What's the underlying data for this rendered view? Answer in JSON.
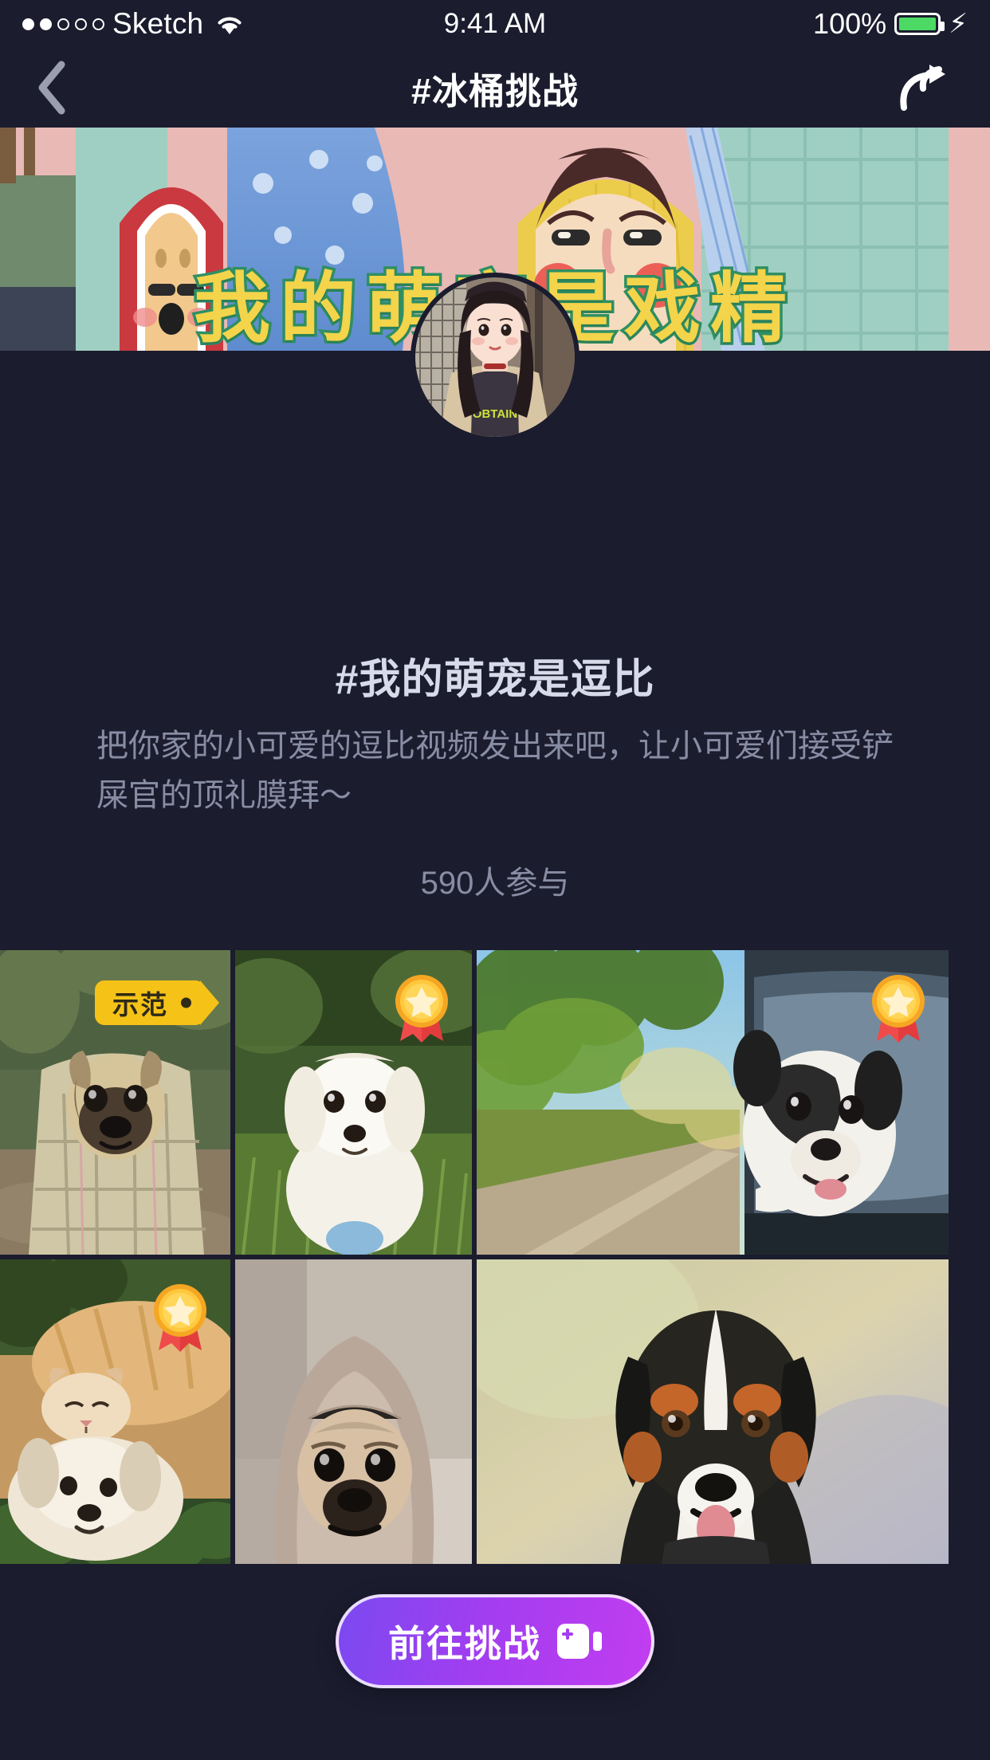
{
  "statusbar": {
    "carrier": "Sketch",
    "time": "9:41 AM",
    "battery_pct": "100%",
    "signal_dots_filled": 2,
    "signal_dots_total": 5,
    "wifi_icon": "wifi-icon",
    "battery_icon": "battery-icon",
    "charging_icon": "lightning-bolt-icon",
    "colors": {
      "battery_fill": "#4cd964",
      "bar_bg": "#1b1c2e"
    }
  },
  "navbar": {
    "title": "#冰桶挑战",
    "back_icon": "chevron-left-icon",
    "share_icon": "share-arrow-icon"
  },
  "banner": {
    "caption": "我的萌宠是戏精",
    "caption_chars": [
      "我",
      "的",
      "萌",
      "宠",
      "是",
      "戏",
      "精"
    ],
    "alt": "illustration-dog-and-person-banner",
    "colors": {
      "text": "#f3d44a",
      "stroke": "#2f8f63"
    }
  },
  "profile": {
    "avatar_name": "user-avatar",
    "hashtag_title": "#我的萌宠是逗比",
    "description": "把你家的小可爱的逗比视频发出来吧，让小可爱们接受铲屎官的顶礼膜拜～",
    "participants": "590人参与"
  },
  "grid": {
    "items": [
      {
        "name": "grid-item-1",
        "alt": "pug-wrapped-in-blanket",
        "badge": "demo",
        "badge_label": "示范"
      },
      {
        "name": "grid-item-2",
        "alt": "white-maltese-puppy-in-grass",
        "badge": "medal"
      },
      {
        "name": "grid-item-3",
        "alt": "bulldog-head-out-of-car-window",
        "badge": "medal"
      },
      {
        "name": "grid-item-4",
        "alt": "cat-and-dog-cuddling",
        "badge": "medal"
      },
      {
        "name": "grid-item-5",
        "alt": "pug-in-hoodie",
        "badge": "none"
      },
      {
        "name": "grid-item-6",
        "alt": "bernese-mountain-dog-portrait",
        "badge": "none"
      }
    ]
  },
  "cta": {
    "label": "前往挑战",
    "icon": "video-camera-icon",
    "gradient_from": "#7b49f0",
    "gradient_to": "#c23df0"
  }
}
